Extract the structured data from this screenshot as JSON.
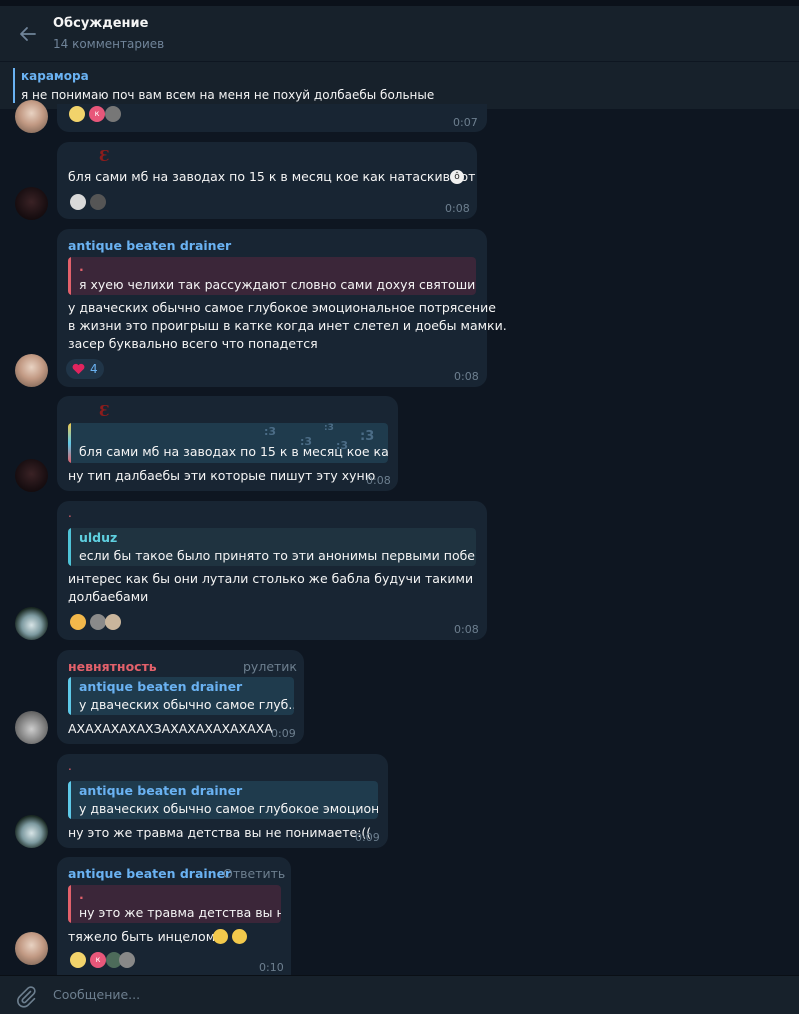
{
  "header": {
    "title": "Обсуждение",
    "subtitle": "14 комментариев"
  },
  "pinned": {
    "name": "карамора",
    "text": "я не понимаю поч вам всем на меня не похуй долбаебы больные"
  },
  "messages": [
    {
      "time": "0:07"
    },
    {
      "mark": "Ɛ",
      "text": "бля сами мб  на заводах по 15 к в месяц кое как натаскивают",
      "time": "0:08"
    },
    {
      "sender": "antique beaten drainer",
      "reply_name": ".",
      "reply_text": "я хуею челихи так рассуждают словно сами дохуя святоши и ...",
      "lines": [
        "у дваческих обычно самое глубокое эмоциональное потрясение",
        "в жизни это проигрыш в катке когда инет слетел и доебы мамки.",
        "засер буквально всего что попадется"
      ],
      "reaction_count": "4",
      "time": "0:08"
    },
    {
      "mark": "Ɛ",
      "reply_text": "бля сами мб  на заводах по 15 к в месяц кое ка...",
      "sticker_marks": [
        ":3",
        ":3",
        ":3",
        ":3",
        ":3"
      ],
      "text": "ну тип далбаебы эти которые пишут эту хуню",
      "time": "0:08"
    },
    {
      "sender": ".",
      "reply_name": "ulduz",
      "reply_text": "если бы такое было принято то эти анонимы первыми побе...",
      "lines": [
        "интерес как бы они лутали столько же бабла будучи такими",
        "долбаебами"
      ],
      "time": "0:08"
    },
    {
      "sender": "невнятность",
      "badge": "рулетик",
      "reply_name": "antique beaten drainer",
      "reply_text": "у дваческих обычно самое глуб...",
      "text": "АХАХАХАХАХЗАХАХАХАХАХАХА",
      "time": "0:09"
    },
    {
      "sender": ".",
      "reply_name": "antique beaten drainer",
      "reply_text": "у дваческих обычно самое глубокое эмоцион...",
      "text": "ну это же травма детства вы не понимаете:((",
      "time": "0:09"
    },
    {
      "sender": "antique beaten drainer",
      "action": "Ответить",
      "reply_name": ".",
      "reply_text": "ну это же травма детства вы н...",
      "text": "тяжело быть инцелом",
      "time": "0:10"
    }
  ],
  "composer": {
    "placeholder": "Сообщение..."
  },
  "colors": {
    "background": "#0e1621",
    "bubble": "#182533",
    "accent": "#6ab2f2",
    "red_name": "#e2616b"
  }
}
